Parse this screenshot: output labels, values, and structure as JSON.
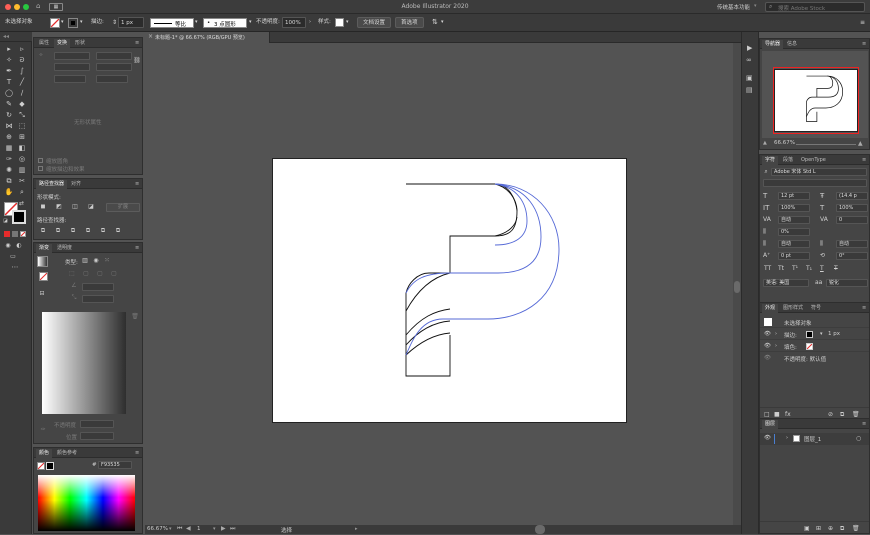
{
  "app_title": "Adobe Illustrator 2020",
  "workspace": "传统基本功能",
  "search_placeholder": "搜索 Adobe Stock",
  "controlbar": {
    "selection": "未选择对象",
    "stroke_label": "描边:",
    "stroke_value": "1 px",
    "profile_label": "等比",
    "brush_label": "3 点圆形",
    "opacity_label": "不透明度:",
    "opacity_value": "100%",
    "style_label": "样式:",
    "doc_setup": "文档设置",
    "preferences": "首选项"
  },
  "doc_tab": "未标题-1* @ 66.67% (RGB/GPU 预览)",
  "left_panels": {
    "properties_tabs": [
      "属性",
      "变换",
      "形状"
    ],
    "no_properties": "无形状属性",
    "check1": "缩放圆角",
    "check2": "缩放描边和效果",
    "pathfinder_tabs": [
      "路径查找器",
      "对齐"
    ],
    "shape_modes": "形状模式:",
    "expand": "扩展",
    "pathfinders": "路径查找器:",
    "gradient_tabs": [
      "渐变",
      "透明度"
    ],
    "type_label": "类型:",
    "opacity_label": "不透明度",
    "location_label": "位置",
    "color_tabs": [
      "颜色",
      "颜色参考"
    ],
    "hex_value": "F93535"
  },
  "statusbar": {
    "zoom": "66.67%",
    "artboard_num": "1",
    "mode": "选择"
  },
  "right_panels": {
    "nav_tabs": [
      "导航器",
      "信息"
    ],
    "nav_zoom": "66.67%",
    "char_tabs": [
      "字符",
      "段落",
      "OpenType"
    ],
    "font_family": "Adobe 宋体 Std L",
    "font_size": "12 pt",
    "leading": "(14.4 p",
    "h_scale": "100%",
    "v_scale": "100%",
    "kerning": "自动",
    "tracking": "0",
    "tsume": "0%",
    "aki_left": "自动",
    "aki_right": "自动",
    "baseline": "0 pt",
    "rotation": "0°",
    "language": "英语: 美国",
    "aa": "锐化",
    "appearance_tabs": [
      "外观",
      "图形样式",
      "符号"
    ],
    "no_selection": "未选择对象",
    "stroke_row": "描边:",
    "stroke_weight": "1 px",
    "fill_row": "填色:",
    "opacity_row": "不透明度: 默认值",
    "layers_tab": "图层",
    "layer_name": "图层_1"
  },
  "colors": {
    "accent": "#4a8fe0",
    "fill_swatch_stroke": "#e52b2b",
    "layer_color": "#4a7fd1"
  }
}
